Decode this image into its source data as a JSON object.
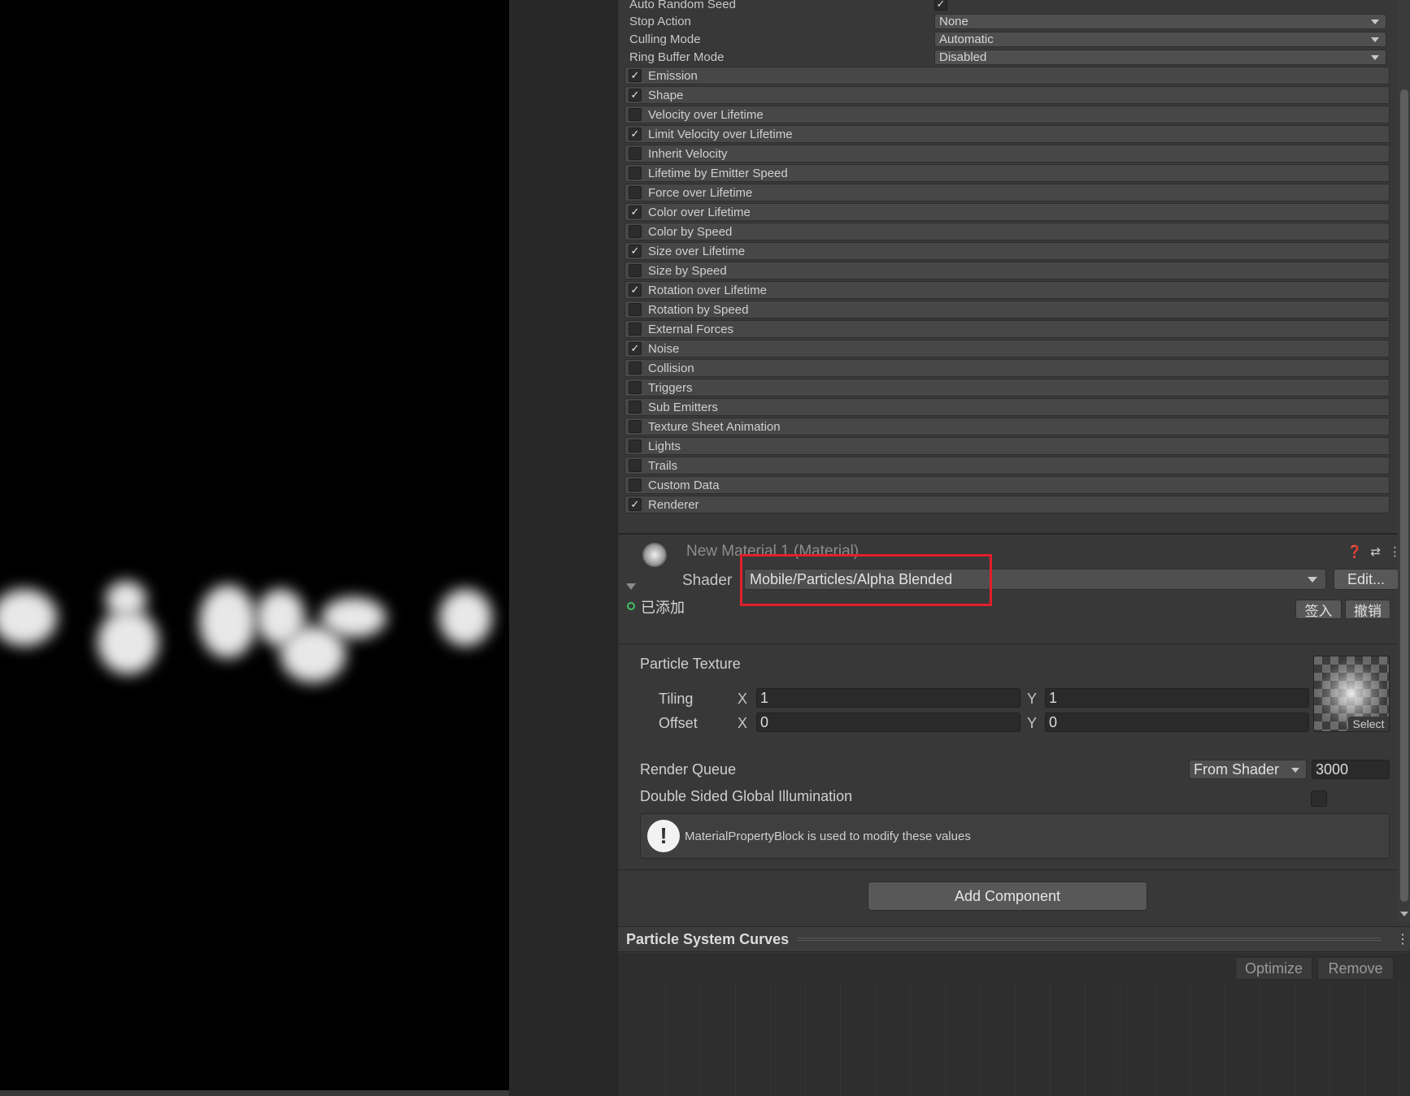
{
  "main_props": [
    {
      "label": "Auto Random Seed",
      "type": "checkbox",
      "checked": true
    },
    {
      "label": "Stop Action",
      "type": "dropdown",
      "value": "None"
    },
    {
      "label": "Culling Mode",
      "type": "dropdown",
      "value": "Automatic"
    },
    {
      "label": "Ring Buffer Mode",
      "type": "dropdown",
      "value": "Disabled"
    }
  ],
  "modules": [
    {
      "label": "Emission",
      "enabled": true
    },
    {
      "label": "Shape",
      "enabled": true
    },
    {
      "label": "Velocity over Lifetime",
      "enabled": false
    },
    {
      "label": "Limit Velocity over Lifetime",
      "enabled": true
    },
    {
      "label": "Inherit Velocity",
      "enabled": false
    },
    {
      "label": "Lifetime by Emitter Speed",
      "enabled": false
    },
    {
      "label": "Force over Lifetime",
      "enabled": false
    },
    {
      "label": "Color over Lifetime",
      "enabled": true
    },
    {
      "label": "Color by Speed",
      "enabled": false
    },
    {
      "label": "Size over Lifetime",
      "enabled": true
    },
    {
      "label": "Size by Speed",
      "enabled": false
    },
    {
      "label": "Rotation over Lifetime",
      "enabled": true
    },
    {
      "label": "Rotation by Speed",
      "enabled": false
    },
    {
      "label": "External Forces",
      "enabled": false
    },
    {
      "label": "Noise",
      "enabled": true
    },
    {
      "label": "Collision",
      "enabled": false
    },
    {
      "label": "Triggers",
      "enabled": false
    },
    {
      "label": "Sub Emitters",
      "enabled": false
    },
    {
      "label": "Texture Sheet Animation",
      "enabled": false
    },
    {
      "label": "Lights",
      "enabled": false
    },
    {
      "label": "Trails",
      "enabled": false
    },
    {
      "label": "Custom Data",
      "enabled": false
    },
    {
      "label": "Renderer",
      "enabled": true
    }
  ],
  "material": {
    "title": "New Material 1 (Material)",
    "shader_label": "Shader",
    "shader_value": "Mobile/Particles/Alpha Blended",
    "edit_label": "Edit...",
    "added_label": "已添加",
    "checkin_label": "签入",
    "revert_label": "撤销",
    "icons": [
      "help-icon",
      "preset-icon",
      "more-icon"
    ],
    "highlight_color": "#e0202a"
  },
  "texture": {
    "section_label": "Particle Texture",
    "tiling_label": "Tiling",
    "offset_label": "Offset",
    "x_label": "X",
    "y_label": "Y",
    "tiling_x": "1",
    "tiling_y": "1",
    "offset_x": "0",
    "offset_y": "0",
    "select_label": "Select"
  },
  "render_queue": {
    "label": "Render Queue",
    "mode": "From Shader",
    "value": "3000"
  },
  "dsgi": {
    "label": "Double Sided Global Illumination",
    "checked": false
  },
  "help_box": {
    "icon": "warning-icon",
    "text": "MaterialPropertyBlock is used to modify these values"
  },
  "add_component_label": "Add Component",
  "curves": {
    "title": "Particle System Curves",
    "optimize_label": "Optimize",
    "remove_label": "Remove"
  }
}
